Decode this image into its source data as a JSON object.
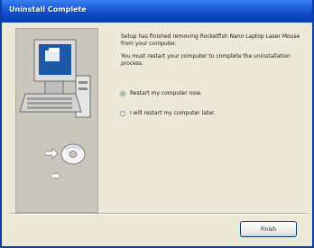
{
  "window": {
    "title": "Uninstall Complete"
  },
  "message": {
    "line1": "Setup has finished removing Rocketfish Nano Laptop Laser Mouse from your computer.",
    "line2": "You must restart your computer to complete the uninstallation process."
  },
  "options": [
    {
      "label": "Restart my computer now.",
      "selected": true
    },
    {
      "label": "I will restart my computer later.",
      "selected": false
    }
  ],
  "buttons": {
    "finish": "Finish"
  },
  "icons": [
    "computer-icon",
    "arrow-icon",
    "cd-disc-icon"
  ]
}
